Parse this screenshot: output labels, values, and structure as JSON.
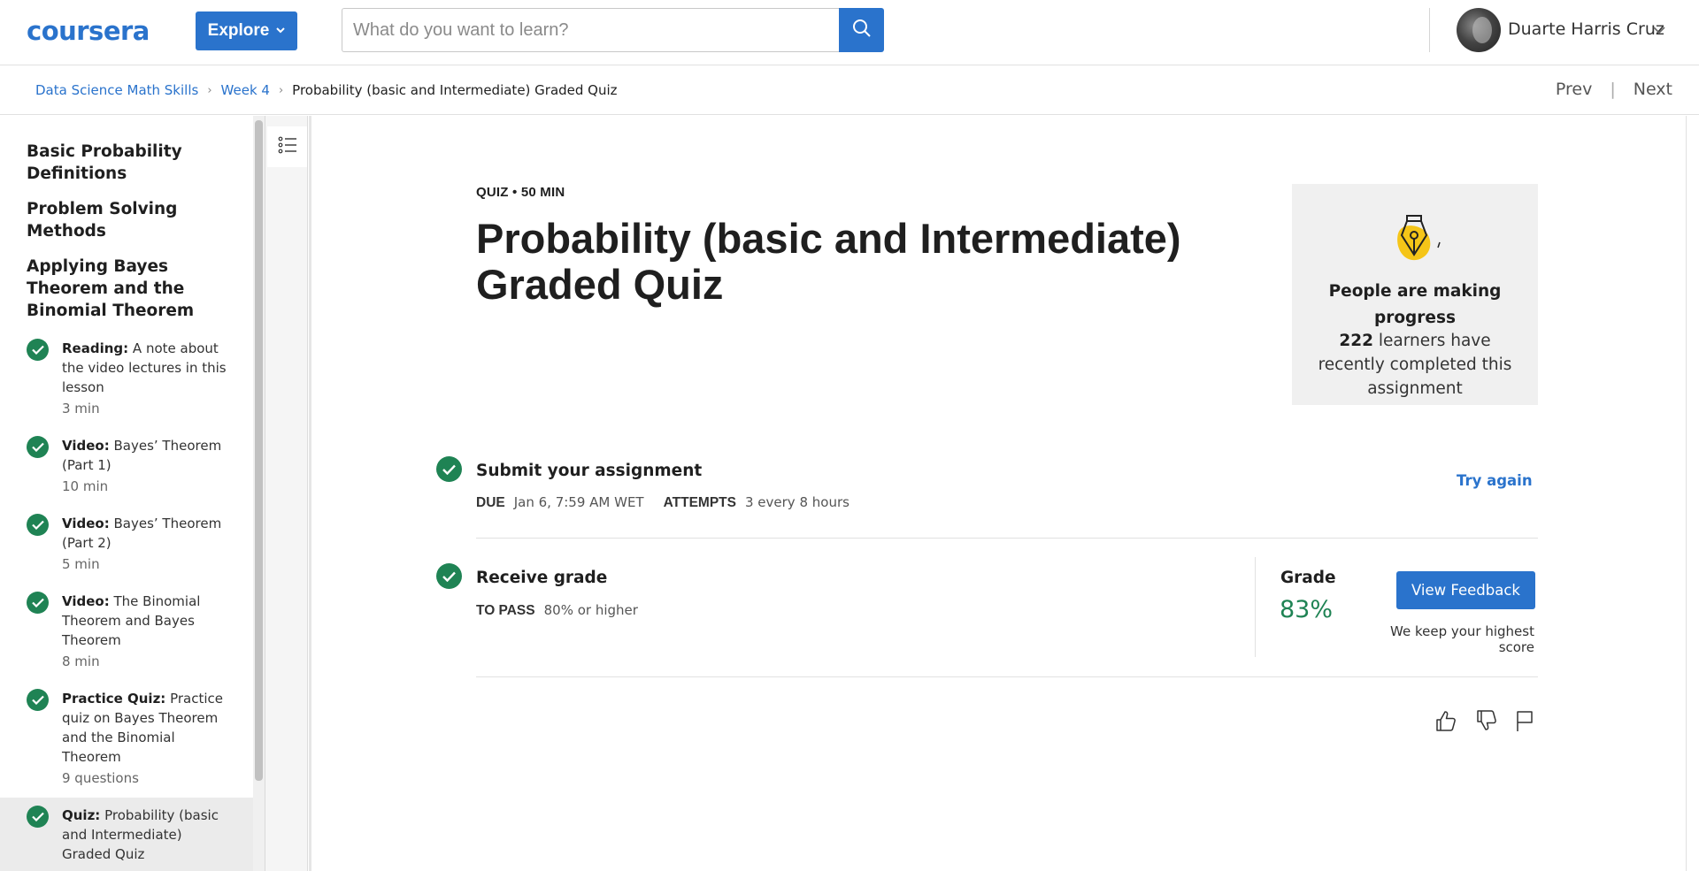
{
  "header": {
    "logo": "coursera",
    "explore_label": "Explore",
    "search_placeholder": "What do you want to learn?",
    "user_name": "Duarte Harris Cruz"
  },
  "breadcrumb": {
    "items": [
      "Data Science Math Skills",
      "Week 4"
    ],
    "current": "Probability (basic and Intermediate) Graded Quiz",
    "prev": "Prev",
    "next": "Next",
    "separator": "|"
  },
  "sidebar": {
    "sections": [
      "Basic Probability Definitions",
      "Problem Solving Methods",
      "Applying Bayes Theorem and the Binomial Theorem"
    ],
    "items": [
      {
        "type": "Reading:",
        "title": "A note about the video lectures in this lesson",
        "duration": "3 min"
      },
      {
        "type": "Video:",
        "title": "Bayes’ Theorem (Part 1)",
        "duration": "10 min"
      },
      {
        "type": "Video:",
        "title": "Bayes’ Theorem (Part 2)",
        "duration": "5 min"
      },
      {
        "type": "Video:",
        "title": "The Binomial Theorem and Bayes Theorem",
        "duration": "8 min"
      },
      {
        "type": "Practice Quiz:",
        "title": "Practice quiz on Bayes Theorem and the Binomial Theorem",
        "duration": "9 questions"
      },
      {
        "type": "Quiz:",
        "title": "Probability (basic and Intermediate) Graded Quiz",
        "duration": ""
      }
    ]
  },
  "main": {
    "eyebrow": "QUIZ • 50 MIN",
    "title": "Probability (basic and Intermediate) Graded Quiz",
    "progress_card": {
      "heading": "People are making progress",
      "count": "222",
      "body": "learners have recently completed this assignment"
    },
    "submit": {
      "title": "Submit your assignment",
      "due_label": "DUE",
      "due_value": "Jan 6, 7:59 AM WET",
      "attempts_label": "ATTEMPTS",
      "attempts_value": "3 every 8 hours",
      "try_again": "Try again"
    },
    "receive": {
      "title": "Receive grade",
      "to_pass_label": "TO PASS",
      "to_pass_value": "80% or higher",
      "grade_label": "Grade",
      "grade_value": "83%",
      "feedback_button": "View Feedback",
      "highest_note": "We keep your highest score"
    }
  },
  "colors": {
    "brand_blue": "#2a73cc",
    "success_green": "#1f8354"
  }
}
